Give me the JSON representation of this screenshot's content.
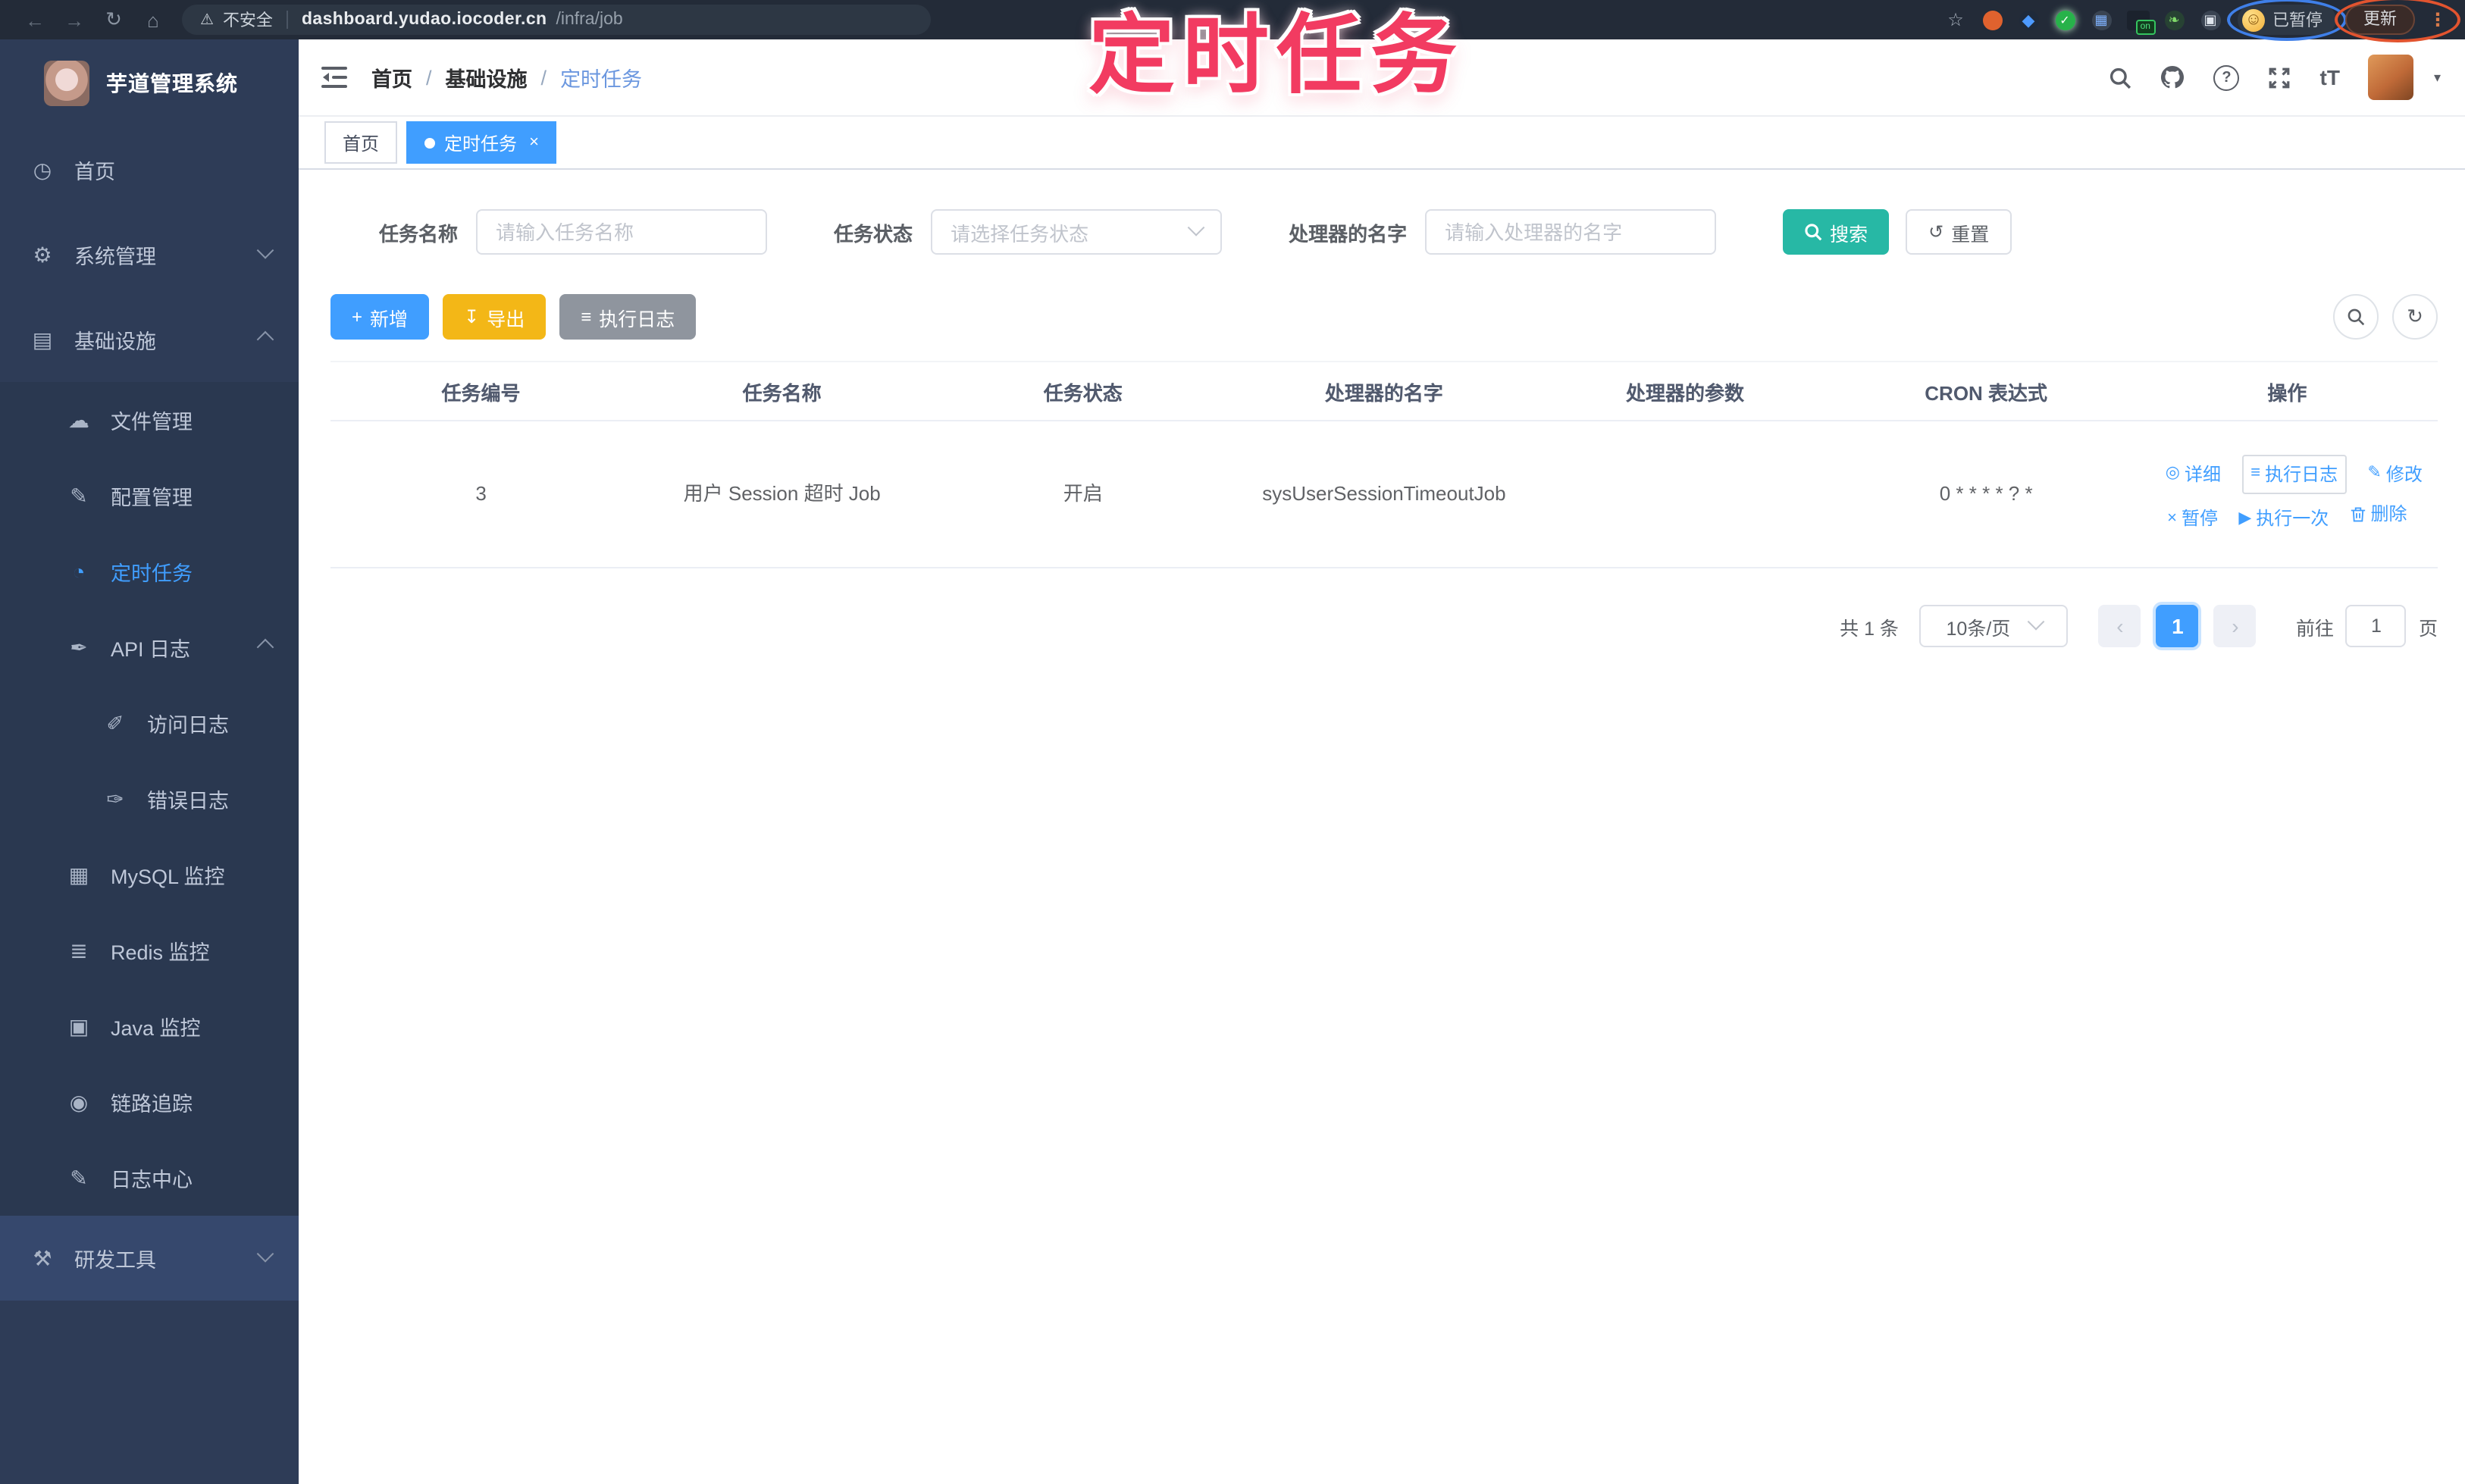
{
  "browser": {
    "security_label": "不安全",
    "url_domain": "dashboard.yudao.iocoder.cn",
    "url_path": "/infra/job",
    "paused_badge": "已暂停",
    "update_button": "更新",
    "extension_on_badge": "on"
  },
  "annotation": {
    "title": "定时任务",
    "color": "#f23b61",
    "oval_blue": "#3f7fe8",
    "oval_orange": "#e2542f"
  },
  "icons": {
    "back": "←",
    "forward": "→",
    "reload": "↻",
    "home": "⌂",
    "warning": "⚠",
    "star": "☆",
    "menu_dots": "⋮",
    "face": "☺",
    "gem": "◆",
    "check": "✓",
    "grid": "▦",
    "leaf": "❧",
    "puzzle": "▣",
    "dashboard": "◷",
    "gear": "⚙",
    "infra": "▤",
    "cloud": "☁",
    "config": "✎",
    "timer": "◔",
    "api": "✒",
    "access": "✐",
    "error": "✑",
    "mysql": "▦",
    "redis": "≣",
    "java": "▣",
    "trace": "◉",
    "logcenter": "✎",
    "devtools": "⚒",
    "plus": "+",
    "export": "↧",
    "list": "≡",
    "reset": "↺",
    "refresh": "↻",
    "detail": "◎",
    "edit": "✎",
    "pause": "×",
    "play": "▶",
    "close": "×",
    "crumb_sep": "/",
    "caret": "▾",
    "question": "?",
    "text_size": "tT"
  },
  "sidebar": {
    "app_title": "芋道管理系统",
    "items": [
      {
        "label": "首页"
      },
      {
        "label": "系统管理"
      },
      {
        "label": "基础设施"
      },
      {
        "label": "文件管理"
      },
      {
        "label": "配置管理"
      },
      {
        "label": "定时任务"
      },
      {
        "label": "API 日志"
      },
      {
        "label": "访问日志"
      },
      {
        "label": "错误日志"
      },
      {
        "label": "MySQL 监控"
      },
      {
        "label": "Redis 监控"
      },
      {
        "label": "Java 监控"
      },
      {
        "label": "链路追踪"
      },
      {
        "label": "日志中心"
      },
      {
        "label": "研发工具"
      }
    ]
  },
  "navbar": {
    "breadcrumb": [
      "首页",
      "基础设施",
      "定时任务"
    ]
  },
  "tabs": [
    {
      "label": "首页",
      "active": false
    },
    {
      "label": "定时任务",
      "active": true
    }
  ],
  "filters": {
    "fields": [
      {
        "label": "任务名称",
        "placeholder": "请输入任务名称"
      },
      {
        "label": "任务状态",
        "placeholder": "请选择任务状态"
      },
      {
        "label": "处理器的名字",
        "placeholder": "请输入处理器的名字"
      }
    ],
    "search": "搜索",
    "reset": "重置"
  },
  "toolbar": {
    "add": "新增",
    "export": "导出",
    "exec_log": "执行日志"
  },
  "table": {
    "headers": [
      "任务编号",
      "任务名称",
      "任务状态",
      "处理器的名字",
      "处理器的参数",
      "CRON 表达式",
      "操作"
    ],
    "rows": [
      {
        "id": "3",
        "name": "用户 Session 超时 Job",
        "status": "开启",
        "handler": "sysUserSessionTimeoutJob",
        "param": "",
        "cron": "0 * * * * ? *",
        "actions": [
          "详细",
          "执行日志",
          "修改",
          "暂停",
          "执行一次",
          "删除"
        ]
      }
    ]
  },
  "pagination": {
    "total": "共 1 条",
    "page_size": "10条/页",
    "prev": "‹",
    "next": "›",
    "current_page": "1",
    "goto_label": "前往",
    "goto_value": "1",
    "goto_unit": "页"
  }
}
